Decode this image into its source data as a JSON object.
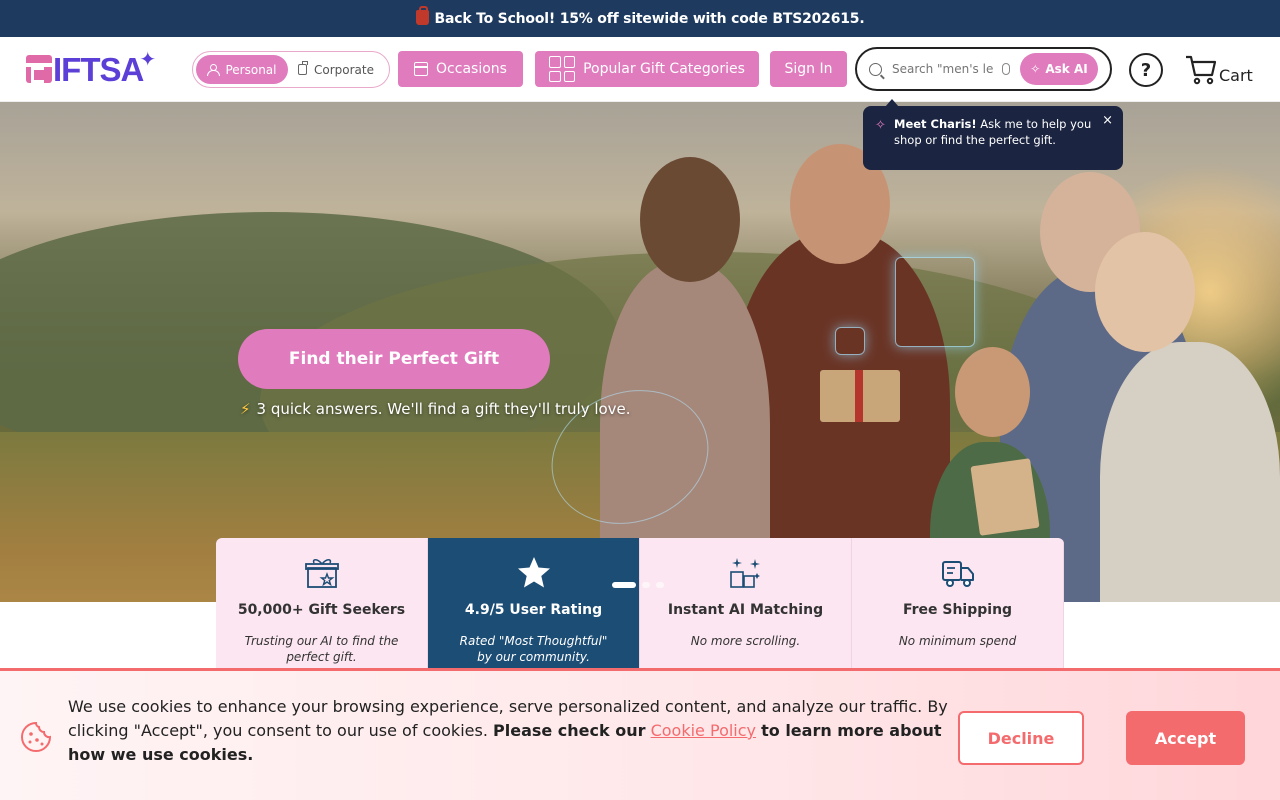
{
  "promo": {
    "text": "Back To School! 15% off sitewide with code BTS202615."
  },
  "logo": {
    "text": "IFTSA"
  },
  "header": {
    "segment": {
      "personal": "Personal",
      "corporate": "Corporate"
    },
    "occasions": "Occasions",
    "categories": "Popular Gift Categories",
    "sign_in": "Sign In",
    "search_placeholder": "Search \"men's lea",
    "ask_ai": "Ask AI",
    "help": "?",
    "cart": "Cart"
  },
  "tooltip": {
    "bold": "Meet Charis!",
    "text": "Ask me to help you shop or find the perfect gift.",
    "close": "×"
  },
  "hero": {
    "cta": "Find their Perfect Gift",
    "tagline": "3 quick answers. We'll find a gift they'll truly love."
  },
  "features": [
    {
      "title": "50,000+ Gift Seekers",
      "desc": "Trusting our AI to find the perfect gift.",
      "icon": "gift-star-icon"
    },
    {
      "title": "4.9/5 User Rating",
      "desc": "Rated \"Most Thoughtful\" by our community.",
      "icon": "star-icon"
    },
    {
      "title": "Instant AI Matching",
      "desc": "No more scrolling.",
      "icon": "sparkle-gifts-icon"
    },
    {
      "title": "Free Shipping",
      "desc": "No minimum spend",
      "icon": "truck-icon"
    }
  ],
  "cookie": {
    "text1": "We use cookies to enhance your browsing experience, serve personalized content, and analyze our traffic. By clicking \"Accept\", you consent to our use of cookies.",
    "bold1": "Please check our",
    "link": "Cookie Policy",
    "bold2": "to learn more about how we use cookies.",
    "decline": "Decline",
    "accept": "Accept"
  },
  "colors": {
    "navy": "#1e3a5f",
    "pink": "#e07bbd",
    "coral": "#f46b6e",
    "dark_feature": "#1c4d75"
  }
}
